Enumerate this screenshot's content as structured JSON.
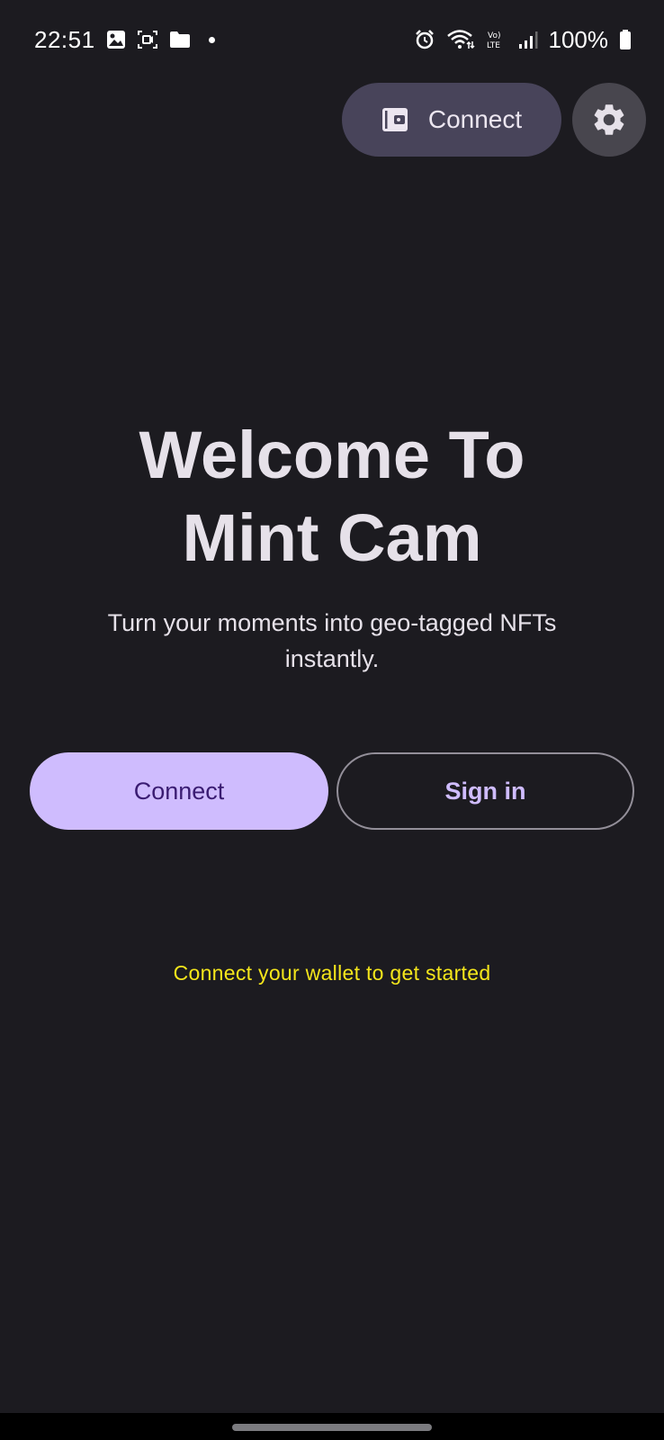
{
  "status_bar": {
    "time": "22:51",
    "left_icons": [
      "gallery-icon",
      "screen-record-icon",
      "folder-icon",
      "notification-dot-icon"
    ],
    "right_icons": [
      "alarm-icon",
      "wifi-icon",
      "volte-icon",
      "signal-icon",
      "battery-icon"
    ],
    "battery": "100%"
  },
  "header": {
    "connect_label": "Connect",
    "connect_icon": "wallet-icon",
    "settings_icon": "gear-icon"
  },
  "hero": {
    "title_line1": "Welcome To",
    "title_line2": "Mint Cam",
    "subtitle": "Turn your moments into geo-tagged NFTs instantly."
  },
  "actions": {
    "connect_label": "Connect",
    "signin_label": "Sign in"
  },
  "hint": "Connect your wallet to get started",
  "colors": {
    "background": "#1c1b20",
    "primary": "#cfbcfe",
    "on_primary": "#3a1c72",
    "hint": "#f5e61b",
    "chip": "#48445a"
  }
}
